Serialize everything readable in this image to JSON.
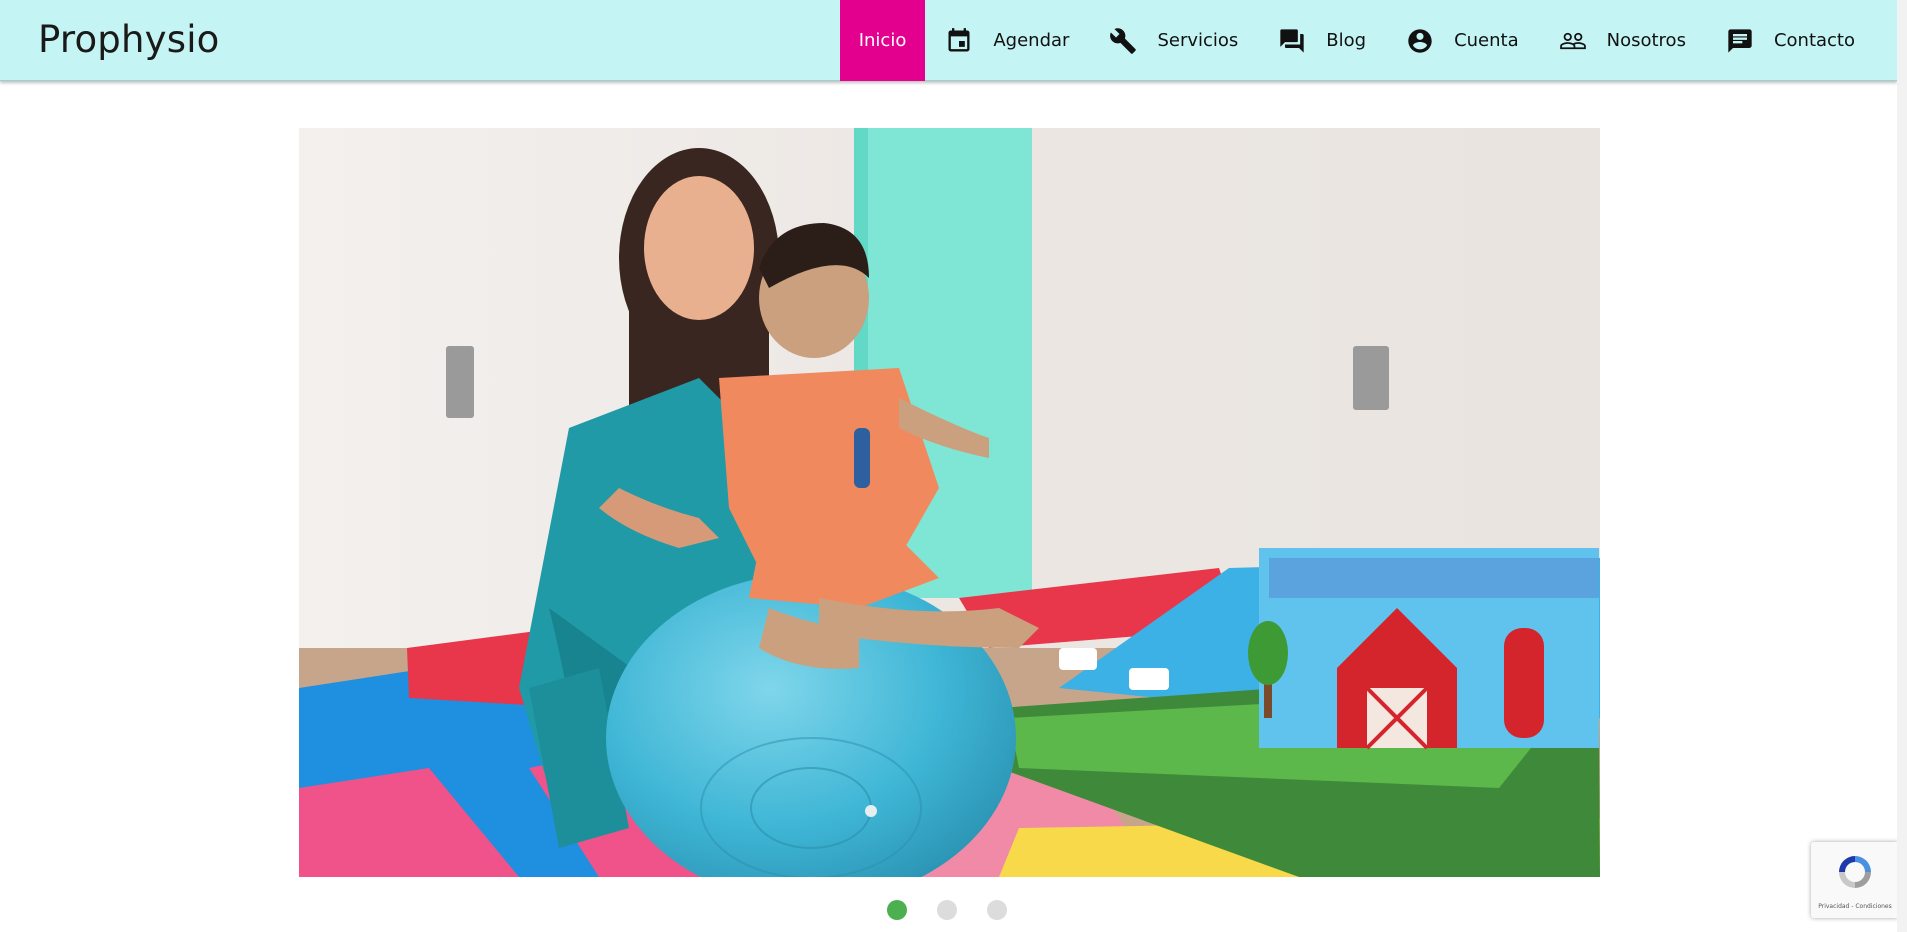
{
  "brand": {
    "name": "Prophysio"
  },
  "nav": {
    "items": [
      {
        "label": "Inicio",
        "icon": "none",
        "active": true
      },
      {
        "label": "Agendar",
        "icon": "calendar-icon",
        "active": false
      },
      {
        "label": "Servicios",
        "icon": "wrench-icon",
        "active": false
      },
      {
        "label": "Blog",
        "icon": "forum-icon",
        "active": false
      },
      {
        "label": "Cuenta",
        "icon": "account-circle-icon",
        "active": false
      },
      {
        "label": "Nosotros",
        "icon": "people-icon",
        "active": false
      },
      {
        "label": "Contacto",
        "icon": "chat-icon",
        "active": false
      }
    ]
  },
  "carousel": {
    "slide_count": 3,
    "active_slide": 1
  },
  "recaptcha": {
    "text": "Privacidad - Condiciones"
  },
  "colors": {
    "header_bg": "#c5f4f4",
    "accent": "#e4008e",
    "dot_active": "#4caf50",
    "dot_inactive": "#dcdcdc"
  }
}
